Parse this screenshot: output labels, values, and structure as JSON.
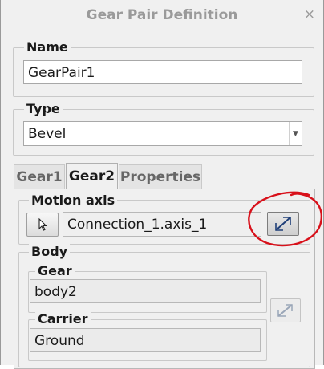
{
  "window": {
    "title": "Gear Pair Definition",
    "close_glyph": "×"
  },
  "name_section": {
    "label": "Name",
    "value": "GearPair1"
  },
  "type_section": {
    "label": "Type",
    "value": "Bevel"
  },
  "tabs": [
    {
      "label": "Gear1",
      "active": false
    },
    {
      "label": "Gear2",
      "active": true
    },
    {
      "label": "Properties",
      "active": false
    }
  ],
  "motion_axis": {
    "label": "Motion axis",
    "value": "Connection_1.axis_1",
    "select_icon": "cursor-arrow-icon",
    "flip_icon": "flip-direction-icon"
  },
  "body": {
    "label": "Body",
    "gear_label": "Gear",
    "gear_value": "body2",
    "carrier_label": "Carrier",
    "carrier_value": "Ground",
    "flip_icon": "flip-direction-icon"
  },
  "colors": {
    "annotation": "#d8101a",
    "title_text": "#9a9a9a"
  }
}
